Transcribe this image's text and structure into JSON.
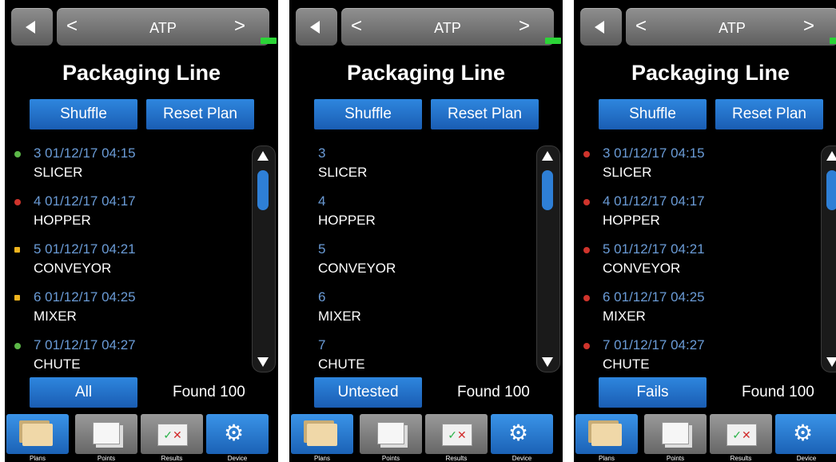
{
  "panels": [
    {
      "header_title": "ATP",
      "page_title": "Packaging Line",
      "shuffle_label": "Shuffle",
      "reset_label": "Reset Plan",
      "filter_label": "All",
      "found_text": "Found 100",
      "items": [
        {
          "meta": "3  01/12/17  04:15",
          "name": "SLICER",
          "status": "pass"
        },
        {
          "meta": "4  01/12/17  04:17",
          "name": "HOPPER",
          "status": "fail"
        },
        {
          "meta": "5  01/12/17  04:21",
          "name": "CONVEYOR",
          "status": "warn"
        },
        {
          "meta": "6  01/12/17  04:25",
          "name": "MIXER",
          "status": "warn"
        },
        {
          "meta": "7  01/12/17  04:27",
          "name": "CHUTE",
          "status": "pass"
        }
      ]
    },
    {
      "header_title": "ATP",
      "page_title": "Packaging Line",
      "shuffle_label": "Shuffle",
      "reset_label": "Reset Plan",
      "filter_label": "Untested",
      "found_text": "Found 100",
      "items": [
        {
          "meta": "3",
          "name": "SLICER",
          "status": "none"
        },
        {
          "meta": "4",
          "name": "HOPPER",
          "status": "none"
        },
        {
          "meta": "5",
          "name": "CONVEYOR",
          "status": "none"
        },
        {
          "meta": "6",
          "name": "MIXER",
          "status": "none"
        },
        {
          "meta": "7",
          "name": "CHUTE",
          "status": "none"
        }
      ]
    },
    {
      "header_title": "ATP",
      "page_title": "Packaging Line",
      "shuffle_label": "Shuffle",
      "reset_label": "Reset Plan",
      "filter_label": "Fails",
      "found_text": "Found 100",
      "items": [
        {
          "meta": "3  01/12/17  04:15",
          "name": "SLICER",
          "status": "fail"
        },
        {
          "meta": "4  01/12/17  04:17",
          "name": "HOPPER",
          "status": "fail"
        },
        {
          "meta": "5  01/12/17  04:21",
          "name": "CONVEYOR",
          "status": "fail"
        },
        {
          "meta": "6  01/12/17  04:25",
          "name": "MIXER",
          "status": "fail"
        },
        {
          "meta": "7  01/12/17  04:27",
          "name": "CHUTE",
          "status": "fail"
        }
      ]
    }
  ],
  "tabs": [
    {
      "label": "Plans",
      "icon": "folder-icon"
    },
    {
      "label": "Points",
      "icon": "sheets-icon"
    },
    {
      "label": "Results",
      "icon": "results-icon"
    },
    {
      "label": "Device",
      "icon": "gear-icon"
    }
  ],
  "colors": {
    "pass": "#5cb848",
    "fail": "#d0342c",
    "warn": "#f0b41e",
    "accent": "#1f6fcc",
    "meta_text": "#6a9bd6"
  }
}
